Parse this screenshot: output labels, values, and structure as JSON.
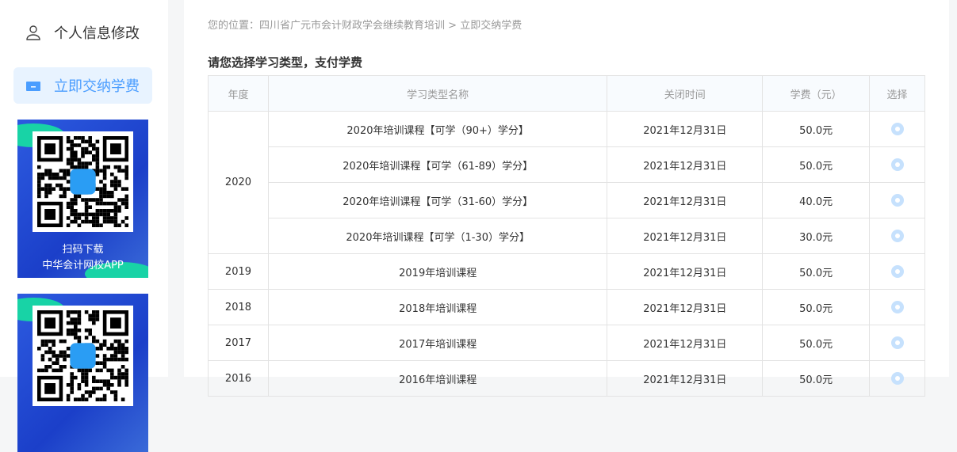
{
  "sidebar": {
    "items": [
      {
        "label": "个人信息修改",
        "icon": "user-icon"
      },
      {
        "label": "立即交纳学费",
        "icon": "wallet-icon",
        "active": true
      }
    ],
    "promo1": {
      "line1": "扫码下载",
      "line2": "中华会计网校APP"
    }
  },
  "breadcrumb": {
    "prefix": "您的位置：",
    "path": "四川省广元市会计财政学会继续教育培训",
    "sep": ">",
    "current": "立即交纳学费"
  },
  "section_title": "请您选择学习类型，支付学费",
  "table": {
    "headers": [
      "年度",
      "学习类型名称",
      "关闭时间",
      "学费（元）",
      "选择"
    ],
    "groups": [
      {
        "year": "2020",
        "rows": [
          {
            "name": "2020年培训课程【可学（90+）学分】",
            "close": "2021年12月31日",
            "fee": "50.0元"
          },
          {
            "name": "2020年培训课程【可学（61-89）学分】",
            "close": "2021年12月31日",
            "fee": "50.0元"
          },
          {
            "name": "2020年培训课程【可学（31-60）学分】",
            "close": "2021年12月31日",
            "fee": "40.0元"
          },
          {
            "name": "2020年培训课程【可学（1-30）学分】",
            "close": "2021年12月31日",
            "fee": "30.0元"
          }
        ]
      },
      {
        "year": "2019",
        "rows": [
          {
            "name": "2019年培训课程",
            "close": "2021年12月31日",
            "fee": "50.0元"
          }
        ]
      },
      {
        "year": "2018",
        "rows": [
          {
            "name": "2018年培训课程",
            "close": "2021年12月31日",
            "fee": "50.0元"
          }
        ]
      },
      {
        "year": "2017",
        "rows": [
          {
            "name": "2017年培训课程",
            "close": "2021年12月31日",
            "fee": "50.0元"
          }
        ]
      },
      {
        "year": "2016",
        "rows": [
          {
            "name": "2016年培训课程",
            "close": "2021年12月31日",
            "fee": "50.0元"
          }
        ]
      }
    ]
  }
}
